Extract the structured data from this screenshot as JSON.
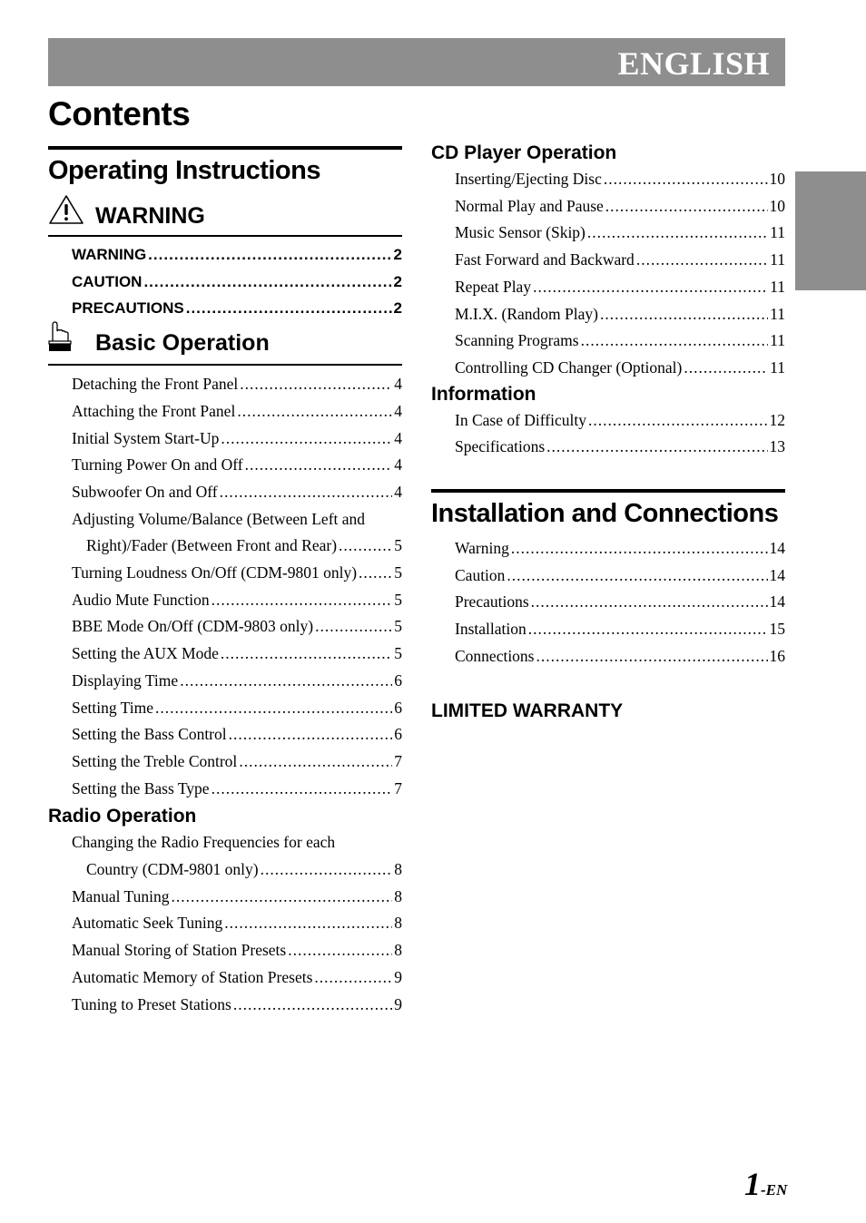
{
  "header": {
    "language_banner": "ENGLISH"
  },
  "title": "Contents",
  "operating_instructions": {
    "title": "Operating Instructions",
    "warning_section": {
      "title": "WARNING",
      "icon": "warning-triangle-icon",
      "items": [
        {
          "label": "WARNING",
          "page": "2"
        },
        {
          "label": "CAUTION",
          "page": "2"
        },
        {
          "label": "PRECAUTIONS",
          "page": "2"
        }
      ]
    },
    "basic_operation": {
      "title": "Basic Operation",
      "icon": "pointing-hand-icon",
      "items": [
        {
          "label": "Detaching the Front Panel",
          "page": "4"
        },
        {
          "label": "Attaching the Front Panel",
          "page": "4"
        },
        {
          "label": "Initial System Start-Up",
          "page": "4"
        },
        {
          "label": "Turning Power On and Off",
          "page": "4"
        },
        {
          "label": "Subwoofer On and Off",
          "page": "4"
        },
        {
          "label": "Adjusting Volume/Balance (Between Left and",
          "continuation": "Right)/Fader (Between Front and Rear)",
          "page": "5"
        },
        {
          "label": "Turning Loudness On/Off (CDM-9801 only)",
          "page": "5"
        },
        {
          "label": "Audio Mute Function",
          "page": "5"
        },
        {
          "label": "BBE Mode On/Off (CDM-9803 only)",
          "page": "5"
        },
        {
          "label": "Setting the AUX Mode",
          "page": "5"
        },
        {
          "label": "Displaying Time",
          "page": "6"
        },
        {
          "label": "Setting Time",
          "page": "6"
        },
        {
          "label": "Setting the Bass Control",
          "page": "6"
        },
        {
          "label": "Setting the Treble Control",
          "page": "7"
        },
        {
          "label": "Setting the Bass Type",
          "page": "7"
        }
      ]
    },
    "radio_operation": {
      "title": "Radio Operation",
      "items": [
        {
          "label": "Changing the Radio Frequencies for each",
          "continuation": "Country (CDM-9801 only)",
          "page": "8"
        },
        {
          "label": "Manual Tuning",
          "page": "8"
        },
        {
          "label": "Automatic Seek Tuning",
          "page": "8"
        },
        {
          "label": "Manual Storing of Station Presets",
          "page": "8"
        },
        {
          "label": "Automatic Memory of Station Presets",
          "page": "9"
        },
        {
          "label": "Tuning to Preset Stations",
          "page": "9"
        }
      ]
    },
    "cd_player_operation": {
      "title": "CD Player Operation",
      "items": [
        {
          "label": "Inserting/Ejecting Disc",
          "page": "10"
        },
        {
          "label": "Normal Play and Pause",
          "page": "10"
        },
        {
          "label": "Music Sensor (Skip)",
          "page": "11"
        },
        {
          "label": "Fast Forward and Backward",
          "page": "11"
        },
        {
          "label": "Repeat Play",
          "page": "11"
        },
        {
          "label": "M.I.X. (Random Play)",
          "page": "11"
        },
        {
          "label": "Scanning Programs",
          "page": "11"
        },
        {
          "label": "Controlling CD Changer (Optional)",
          "page": "11"
        }
      ]
    },
    "information": {
      "title": "Information",
      "items": [
        {
          "label": "In Case of Difficulty",
          "page": "12"
        },
        {
          "label": "Specifications",
          "page": "13"
        }
      ]
    }
  },
  "installation": {
    "title": "Installation and Connections",
    "items": [
      {
        "label": "Warning",
        "page": "14"
      },
      {
        "label": "Caution",
        "page": "14"
      },
      {
        "label": "Precautions",
        "page": "14"
      },
      {
        "label": "Installation",
        "page": "15"
      },
      {
        "label": "Connections",
        "page": "16"
      }
    ]
  },
  "limited_warranty": "LIMITED WARRANTY",
  "footer": {
    "page_number": "1",
    "page_suffix": "-EN"
  },
  "colors": {
    "banner": "#8e8e8e",
    "banner_text": "#ffffff",
    "text": "#000000"
  }
}
